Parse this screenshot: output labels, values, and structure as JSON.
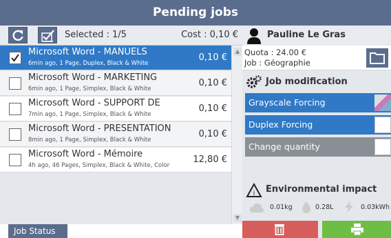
{
  "title": "Pending jobs",
  "toolbar": {
    "selected": "Selected : 1/5",
    "cost": "Cost : 0,10 €"
  },
  "jobs": [
    {
      "name": "Microsoft Word - MANUELS",
      "meta": "6min ago, 1 Page, Duplex, Black & White",
      "price": "0,10 €",
      "checked": true
    },
    {
      "name": "Microsoft Word - MARKETING",
      "meta": "6min ago, 1 Page, Simplex, Black & White",
      "price": "0,10 €",
      "checked": false
    },
    {
      "name": "Microsoft Word - SUPPORT DE",
      "meta": "7min ago, 1 Page, Simplex, Black & White",
      "price": "0,10 €",
      "checked": false
    },
    {
      "name": "Microsoft Word - PRESENTATION",
      "meta": "8min ago, 1 Page, Simplex, Black & White",
      "price": "0,10 €",
      "checked": false
    },
    {
      "name": "Microsoft Word - Mémoire",
      "meta": "4h ago, 46 Pages, Simplex, Black & White, Color",
      "price": "12,80 €",
      "checked": false
    }
  ],
  "job_status_tab": "Job Status",
  "user": {
    "name": "Pauline Le Gras",
    "quota": "Quota : 24.00 €",
    "job": "Job : Géographie"
  },
  "job_modification": {
    "title": "Job modification",
    "grayscale": "Grayscale Forcing",
    "duplex": "Duplex Forcing",
    "change_quantity": "Change quantity"
  },
  "environmental": {
    "title": "Environmental impact",
    "co2": "0.01kg",
    "water": "0.28L",
    "energy": "0.03kWh"
  },
  "colors": {
    "header": "#5b6d8d",
    "selected_row": "#2f79c6",
    "delete": "#d85d5d",
    "print": "#6ebd45"
  },
  "icons": {
    "refresh": "refresh-icon",
    "select_all": "select-all-icon",
    "user": "user-icon",
    "folder": "folder-icon",
    "gear": "gears-icon",
    "recycle": "recycle-icon",
    "cloud": "co2-cloud-icon",
    "drop": "water-drop-icon",
    "bolt": "energy-bolt-icon",
    "trash": "trash-icon",
    "printer": "printer-icon"
  }
}
